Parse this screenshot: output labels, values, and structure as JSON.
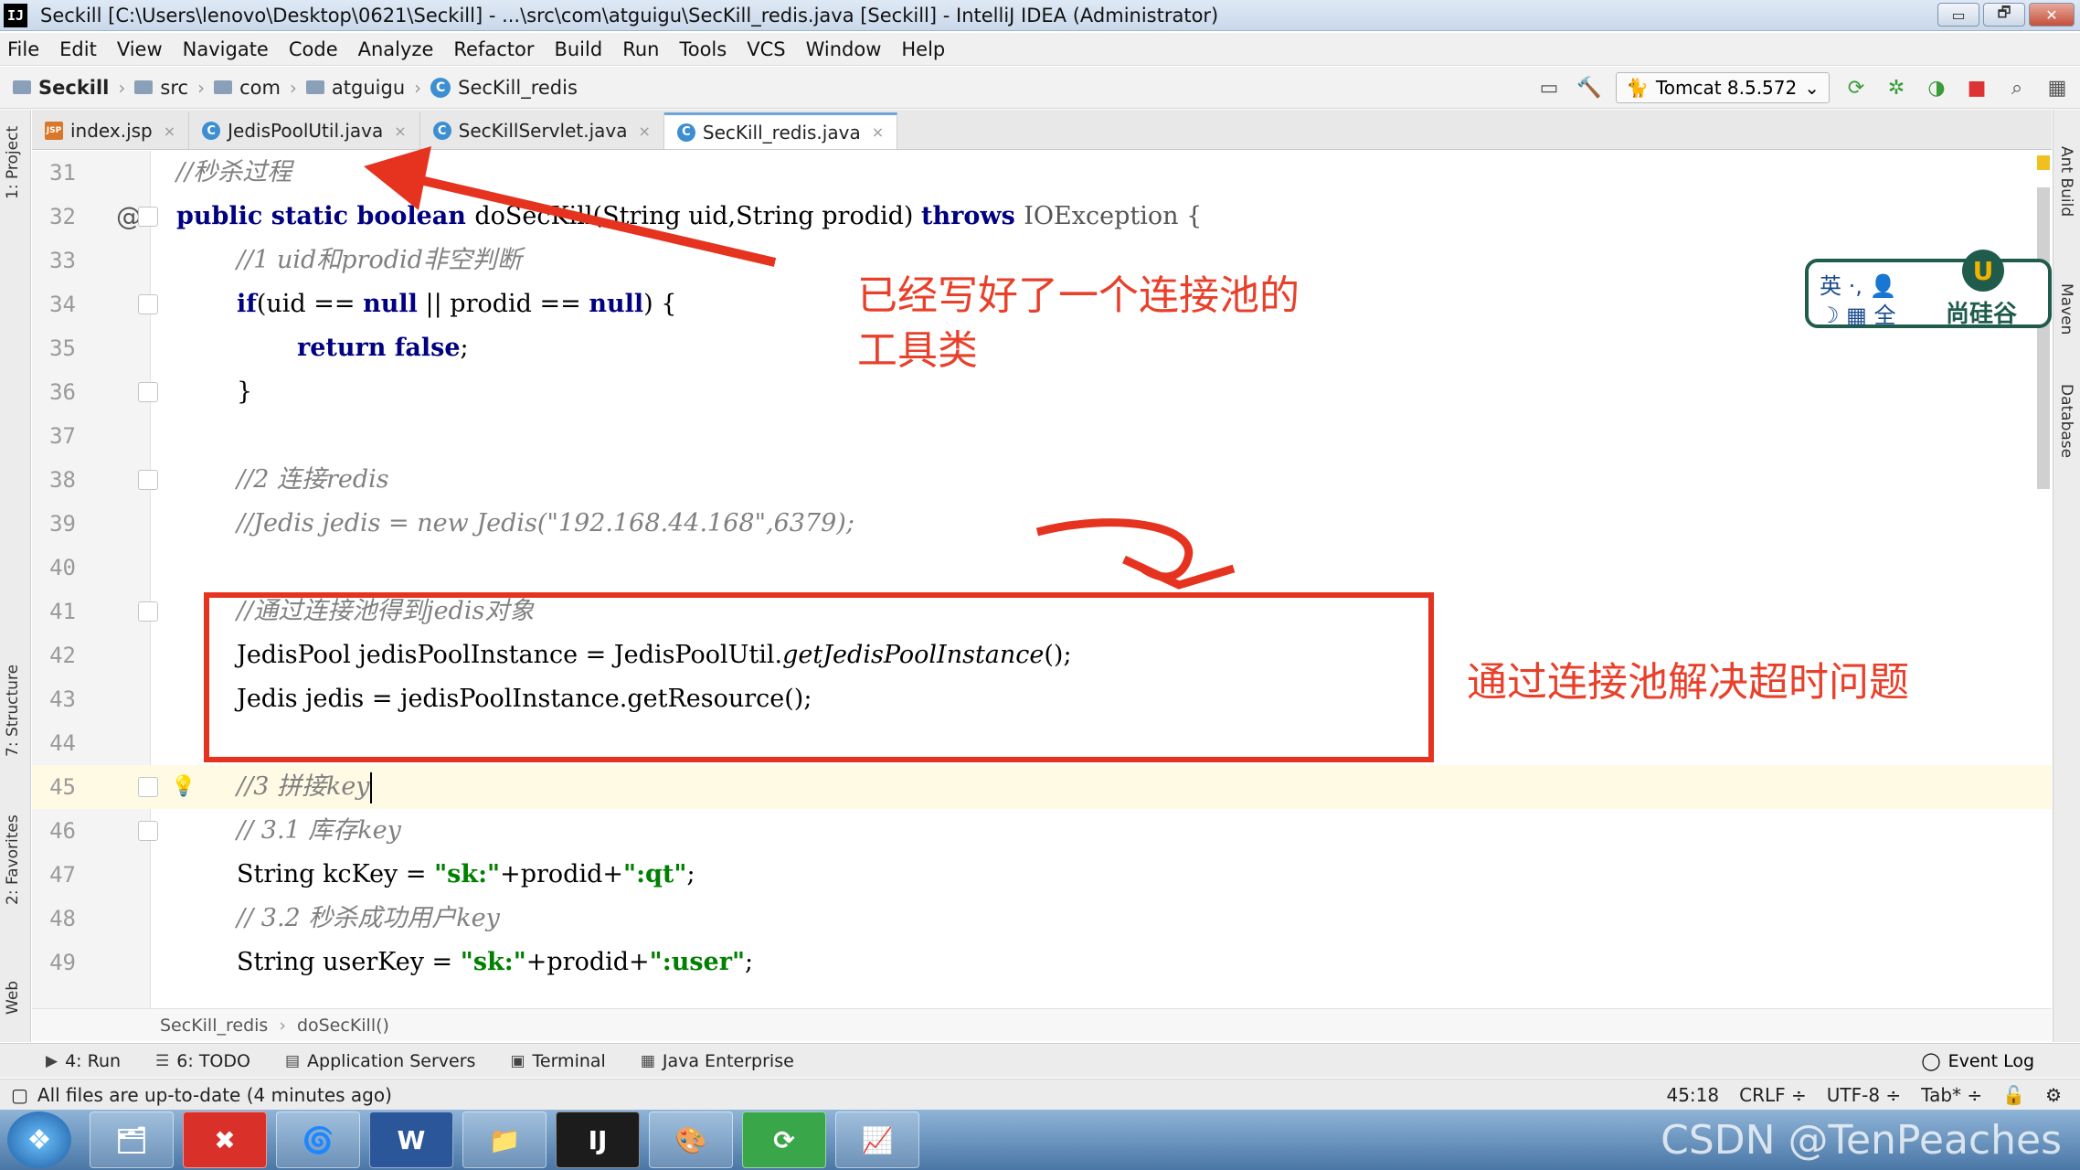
{
  "window": {
    "title": "Seckill [C:\\Users\\lenovo\\Desktop\\0621\\Seckill] - ...\\src\\com\\atguigu\\SecKill_redis.java [Seckill] - IntelliJ IDEA (Administrator)",
    "app_icon": "IJ",
    "minimize": "▭",
    "restore": "🗗",
    "close": "✕"
  },
  "menu": [
    "File",
    "Edit",
    "View",
    "Navigate",
    "Code",
    "Analyze",
    "Refactor",
    "Build",
    "Run",
    "Tools",
    "VCS",
    "Window",
    "Help"
  ],
  "navbar": {
    "crumbs": [
      "Seckill",
      "src",
      "com",
      "atguigu",
      "SecKill_redis"
    ],
    "run_config": "Tomcat 8.5.572"
  },
  "tabs": [
    {
      "label": "index.jsp",
      "icon": "jsp",
      "active": false
    },
    {
      "label": "JedisPoolUtil.java",
      "icon": "C",
      "active": false
    },
    {
      "label": "SecKillServlet.java",
      "icon": "C",
      "active": false
    },
    {
      "label": "SecKill_redis.java",
      "icon": "C",
      "active": true
    }
  ],
  "left_tool_tabs": [
    "1: Project",
    "7: Structure",
    "2: Favorites",
    "Web"
  ],
  "right_tool_tabs": [
    "Ant Build",
    "Maven",
    "Database"
  ],
  "code": {
    "line_numbers": [
      "31",
      "32",
      "33",
      "34",
      "35",
      "36",
      "37",
      "38",
      "39",
      "40",
      "41",
      "42",
      "43",
      "44",
      "45",
      "46",
      "47",
      "48",
      "49"
    ],
    "l31": "//秒杀过程",
    "l32_kw1": "public static boolean ",
    "l32_rest": "doSecKill(String uid,String prodid) ",
    "l32_kw2": "throws ",
    "l32_tail": "IOException {",
    "l33": "//1 uid和prodid非空判断",
    "l34_a": "if",
    "l34_b": "(uid == ",
    "l34_c": "null",
    "l34_d": " || prodid == ",
    "l34_e": "null",
    "l34_f": ") {",
    "l35_a": "return ",
    "l35_b": "false",
    "l35_c": ";",
    "l36": "}",
    "l38": "//2 连接redis",
    "l39": "//Jedis jedis = new Jedis(\"192.168.44.168\",6379);",
    "l41": "//通过连接池得到jedis对象",
    "l42_a": "JedisPool jedisPoolInstance = JedisPoolUtil.",
    "l42_b": "getJedisPoolInstance",
    "l42_c": "();",
    "l43": "Jedis jedis = jedisPoolInstance.getResource();",
    "l45": "//3 拼接key",
    "l46": "// 3.1 库存key",
    "l47_a": "String kcKey = ",
    "l47_b": "\"sk:\"",
    "l47_c": "+prodid+",
    "l47_d": "\":qt\"",
    "l47_e": ";",
    "l48": "// 3.2 秒杀成功用户key",
    "l49_a": "String userKey = ",
    "l49_b": "\"sk:\"",
    "l49_c": "+prodid+",
    "l49_d": "\":user\"",
    "l49_e": ";"
  },
  "annotations": {
    "note1_line1": "已经写好了一个连接池的",
    "note1_line2": "工具类",
    "note2": "通过连接池解决超时问题"
  },
  "ime": {
    "row1": "英 ·, 👤",
    "row2": "☽ ▦ 全",
    "brand": "尚硅谷",
    "logo": "U"
  },
  "editor_breadcrumb": [
    "SecKill_redis",
    "doSecKill()"
  ],
  "tool_windows": [
    {
      "label": "4: Run",
      "icon": "▶"
    },
    {
      "label": "6: TODO",
      "icon": "☰"
    },
    {
      "label": "Application Servers",
      "icon": "▤"
    },
    {
      "label": "Terminal",
      "icon": "▣"
    },
    {
      "label": "Java Enterprise",
      "icon": "▦"
    }
  ],
  "event_log": "Event Log",
  "status": {
    "message": "All files are up-to-date (4 minutes ago)",
    "position": "45:18",
    "line_sep": "CRLF ÷",
    "encoding": "UTF-8 ÷",
    "indent": "Tab* ÷"
  },
  "taskbar": {
    "start": "❖",
    "apps": [
      "🗂",
      "✖",
      "🌀",
      "W",
      "📁",
      "IJ",
      "🎨",
      "⟳",
      "📈"
    ],
    "watermark": "CSDN @TenPeaches"
  },
  "colors": {
    "annotation": "#e5331f",
    "keyword": "#000080",
    "comment": "#808080",
    "string": "#008000"
  }
}
